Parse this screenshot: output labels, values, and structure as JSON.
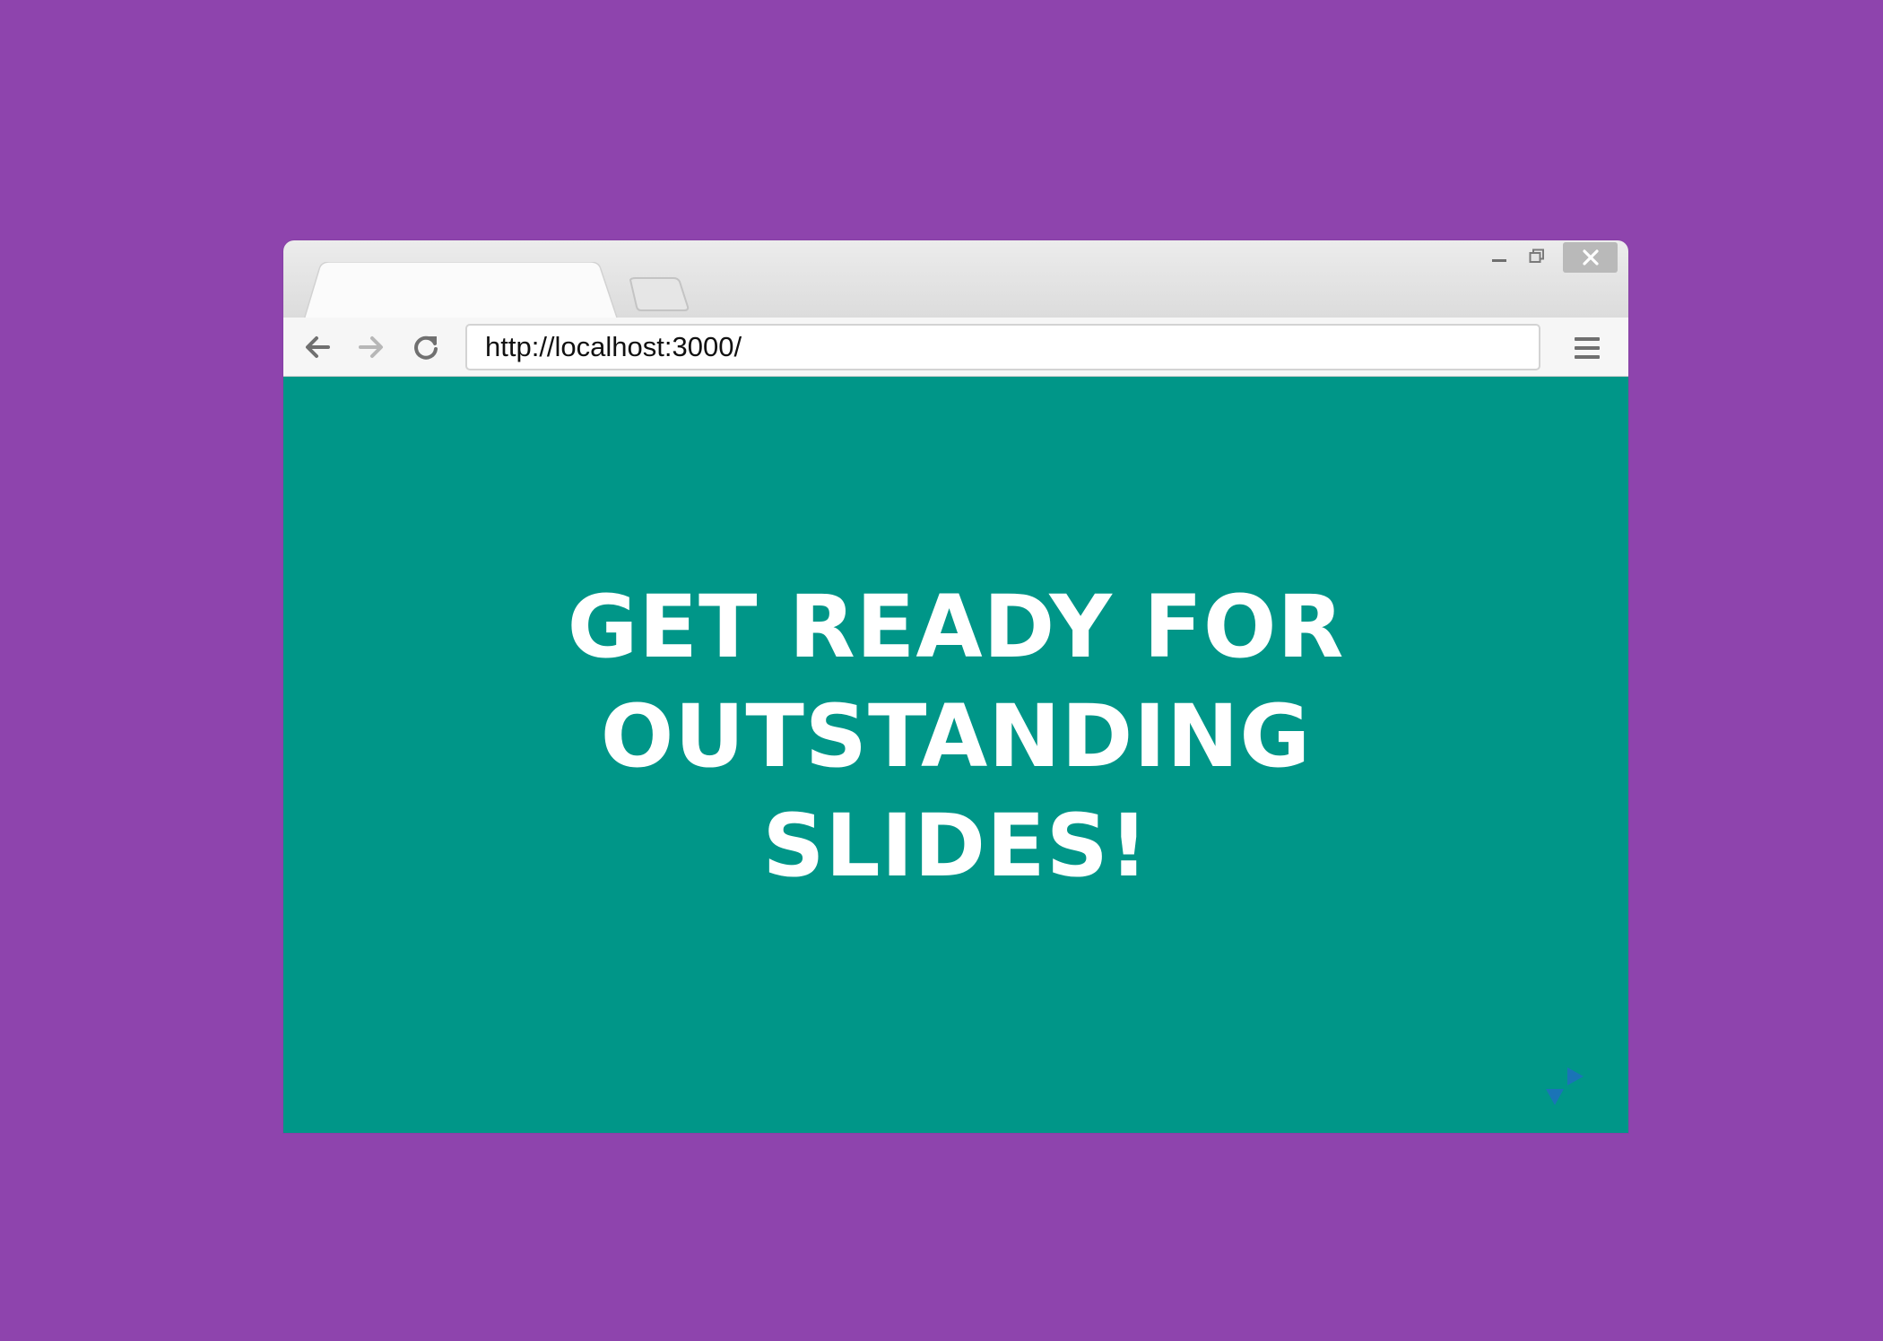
{
  "browser": {
    "url": "http://localhost:3000/",
    "icons": {
      "back": "arrow-left-icon",
      "forward": "arrow-right-icon",
      "reload": "reload-icon",
      "menu": "hamburger-menu-icon",
      "minimize": "minimize-icon",
      "maximize": "maximize-icon",
      "close": "close-icon"
    }
  },
  "slide": {
    "title_lines": [
      "GET READY FOR",
      "OUTSTANDING",
      "SLIDES!"
    ],
    "background": "#009688",
    "text_color": "#ffffff",
    "controls": [
      "next-slide-arrow",
      "down-slide-arrow"
    ]
  },
  "page": {
    "background": "#8e44ad"
  }
}
